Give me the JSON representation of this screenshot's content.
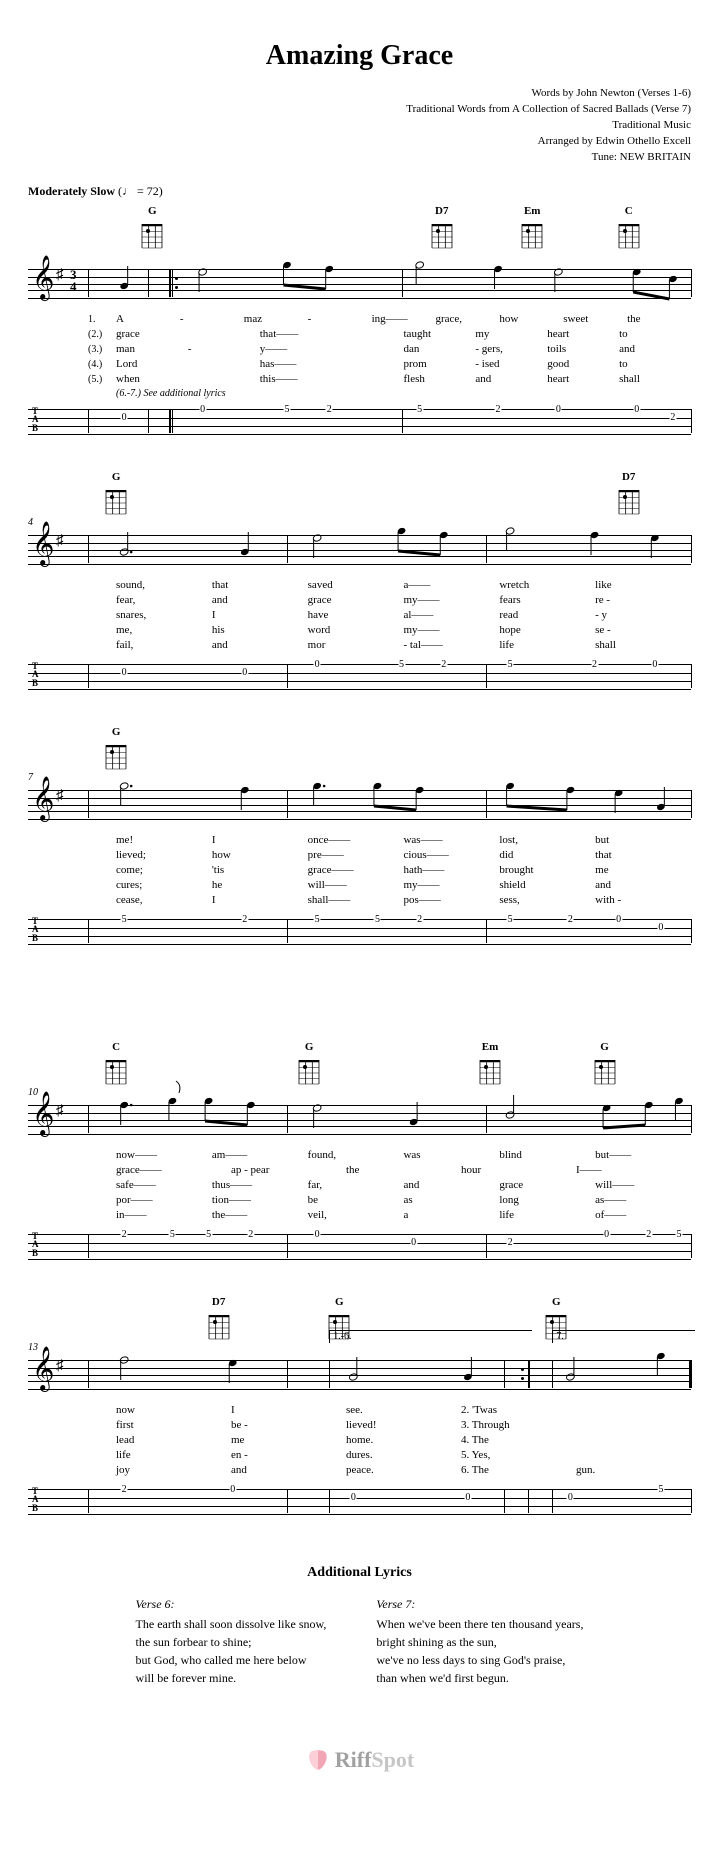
{
  "title": "Amazing Grace",
  "credits": [
    "Words by John Newton (Verses 1-6)",
    "Traditional Words from A Collection of Sacred Ballads (Verse 7)",
    "Traditional Music",
    "Arranged by Edwin Othello Excell",
    "Tune: NEW BRITAIN"
  ],
  "tempo": {
    "label": "Moderately Slow",
    "marking": "(♩ = 72)"
  },
  "time_signature": "3/4",
  "key": "G major",
  "chords_defs": {
    "G": {
      "label": "G"
    },
    "D7": {
      "label": "D7"
    },
    "Em": {
      "label": "Em"
    },
    "C": {
      "label": "C"
    }
  },
  "systems": [
    {
      "measnum": null,
      "chord_slots": [
        {
          "pos": 0.11,
          "chord": "G"
        },
        {
          "pos": 0.59,
          "chord": "D7"
        },
        {
          "pos": 0.74,
          "chord": "Em"
        },
        {
          "pos": 0.9,
          "chord": "C"
        }
      ],
      "barlines": [
        0.0,
        0.1,
        0.14,
        0.52,
        1.0
      ],
      "repeat_start_at": 0.14,
      "lyrics": [
        {
          "num": "1.",
          "syls": [
            "A",
            "-",
            "maz",
            "-",
            "ing——",
            "grace,",
            "how",
            "sweet",
            "the"
          ]
        },
        {
          "num": "(2.)",
          "syls": [
            "grace",
            "",
            "that——",
            "",
            "taught",
            "my",
            "heart",
            "to"
          ]
        },
        {
          "num": "(3.)",
          "syls": [
            "man",
            "-",
            "y——",
            "",
            "dan",
            "- gers,",
            "toils",
            "and"
          ]
        },
        {
          "num": "(4.)",
          "syls": [
            "Lord",
            "",
            "has——",
            "",
            "prom",
            "- ised",
            "good",
            "to"
          ]
        },
        {
          "num": "(5.)",
          "syls": [
            "when",
            "",
            "this——",
            "",
            "flesh",
            "and",
            "heart",
            "shall"
          ]
        }
      ],
      "lyrics_note": "(6.-7.)  See additional lyrics",
      "tab_notes": [
        {
          "pct": 6,
          "str": 1,
          "fret": "0"
        },
        {
          "pct": 19,
          "str": 0,
          "fret": "0"
        },
        {
          "pct": 33,
          "str": 0,
          "fret": "5"
        },
        {
          "pct": 40,
          "str": 0,
          "fret": "2"
        },
        {
          "pct": 55,
          "str": 0,
          "fret": "5"
        },
        {
          "pct": 68,
          "str": 0,
          "fret": "2"
        },
        {
          "pct": 78,
          "str": 0,
          "fret": "0"
        },
        {
          "pct": 91,
          "str": 0,
          "fret": "0"
        },
        {
          "pct": 97,
          "str": 1,
          "fret": "2"
        }
      ],
      "note_heads": [
        {
          "pct": 6,
          "y": 31,
          "stem": "up",
          "filled": true
        },
        {
          "pct": 19,
          "y": 17,
          "stem": "down",
          "filled": false
        },
        {
          "pct": 33,
          "y": 10,
          "stem": "down",
          "filled": true,
          "beam_to": 40
        },
        {
          "pct": 40,
          "y": 14,
          "stem": "down",
          "filled": true
        },
        {
          "pct": 55,
          "y": 10,
          "stem": "down",
          "filled": false
        },
        {
          "pct": 68,
          "y": 14,
          "stem": "down",
          "filled": true
        },
        {
          "pct": 78,
          "y": 17,
          "stem": "down",
          "filled": false
        },
        {
          "pct": 91,
          "y": 17,
          "stem": "down",
          "filled": true,
          "beam_to": 97
        },
        {
          "pct": 97,
          "y": 24,
          "stem": "down",
          "filled": true
        }
      ]
    },
    {
      "measnum": "4",
      "chord_slots": [
        {
          "pos": 0.05,
          "chord": "G"
        },
        {
          "pos": 0.9,
          "chord": "D7"
        }
      ],
      "barlines": [
        0.0,
        0.33,
        0.66,
        1.0
      ],
      "lyrics": [
        {
          "num": "",
          "syls": [
            "sound,",
            "that",
            "saved",
            "a——",
            "wretch",
            "like"
          ]
        },
        {
          "num": "",
          "syls": [
            "fear,",
            "and",
            "grace",
            "my——",
            "fears",
            "re -"
          ]
        },
        {
          "num": "",
          "syls": [
            "snares,",
            "I",
            "have",
            "al——",
            "read",
            "- y"
          ]
        },
        {
          "num": "",
          "syls": [
            "me,",
            "his",
            "word",
            "my——",
            "hope",
            "se -"
          ]
        },
        {
          "num": "",
          "syls": [
            "fail,",
            "and",
            "mor",
            "- tal——",
            "life",
            "shall"
          ]
        }
      ],
      "tab_notes": [
        {
          "pct": 6,
          "str": 1,
          "fret": "0"
        },
        {
          "pct": 26,
          "str": 1,
          "fret": "0"
        },
        {
          "pct": 38,
          "str": 0,
          "fret": "0"
        },
        {
          "pct": 52,
          "str": 0,
          "fret": "5"
        },
        {
          "pct": 59,
          "str": 0,
          "fret": "2"
        },
        {
          "pct": 70,
          "str": 0,
          "fret": "5"
        },
        {
          "pct": 84,
          "str": 0,
          "fret": "2"
        },
        {
          "pct": 94,
          "str": 0,
          "fret": "0"
        }
      ],
      "note_heads": [
        {
          "pct": 6,
          "y": 31,
          "stem": "up",
          "filled": false,
          "dot": true
        },
        {
          "pct": 26,
          "y": 31,
          "stem": "up",
          "filled": true
        },
        {
          "pct": 38,
          "y": 17,
          "stem": "down",
          "filled": false
        },
        {
          "pct": 52,
          "y": 10,
          "stem": "down",
          "filled": true,
          "beam_to": 59
        },
        {
          "pct": 59,
          "y": 14,
          "stem": "down",
          "filled": true
        },
        {
          "pct": 70,
          "y": 10,
          "stem": "down",
          "filled": false
        },
        {
          "pct": 84,
          "y": 14,
          "stem": "down",
          "filled": true
        },
        {
          "pct": 94,
          "y": 17,
          "stem": "down",
          "filled": true
        }
      ]
    },
    {
      "measnum": "7",
      "chord_slots": [
        {
          "pos": 0.05,
          "chord": "G"
        }
      ],
      "barlines": [
        0.0,
        0.33,
        0.66,
        1.0
      ],
      "lyrics": [
        {
          "num": "",
          "syls": [
            "me!",
            "I",
            "once——",
            "was——",
            "lost,",
            "but"
          ]
        },
        {
          "num": "",
          "syls": [
            "lieved;",
            "how",
            "pre——",
            "cious——",
            "did",
            "that"
          ]
        },
        {
          "num": "",
          "syls": [
            "come;",
            "'tis",
            "grace——",
            "hath——",
            "brought",
            "me"
          ]
        },
        {
          "num": "",
          "syls": [
            "cures;",
            "he",
            "will——",
            "my——",
            "shield",
            "and"
          ]
        },
        {
          "num": "",
          "syls": [
            "cease,",
            "I",
            "shall——",
            "pos——",
            "sess,",
            "with -"
          ]
        }
      ],
      "tab_notes": [
        {
          "pct": 6,
          "str": 0,
          "fret": "5"
        },
        {
          "pct": 26,
          "str": 0,
          "fret": "2"
        },
        {
          "pct": 38,
          "str": 0,
          "fret": "5"
        },
        {
          "pct": 48,
          "str": 0,
          "fret": "5"
        },
        {
          "pct": 55,
          "str": 0,
          "fret": "2"
        },
        {
          "pct": 70,
          "str": 0,
          "fret": "5"
        },
        {
          "pct": 80,
          "str": 0,
          "fret": "2"
        },
        {
          "pct": 88,
          "str": 0,
          "fret": "0"
        },
        {
          "pct": 95,
          "str": 1,
          "fret": "0"
        }
      ],
      "note_heads": [
        {
          "pct": 6,
          "y": 10,
          "stem": "down",
          "filled": false,
          "dot": true
        },
        {
          "pct": 26,
          "y": 14,
          "stem": "down",
          "filled": true
        },
        {
          "pct": 38,
          "y": 10,
          "stem": "down",
          "filled": true,
          "dot": true
        },
        {
          "pct": 48,
          "y": 10,
          "stem": "down",
          "filled": true,
          "beam_to": 55
        },
        {
          "pct": 55,
          "y": 14,
          "stem": "down",
          "filled": true
        },
        {
          "pct": 70,
          "y": 10,
          "stem": "down",
          "filled": true,
          "beam_to": 80
        },
        {
          "pct": 80,
          "y": 14,
          "stem": "down",
          "filled": true
        },
        {
          "pct": 88,
          "y": 17,
          "stem": "down",
          "filled": true
        },
        {
          "pct": 95,
          "y": 31,
          "stem": "up",
          "filled": true
        }
      ]
    },
    {
      "measnum": "10",
      "chord_slots": [
        {
          "pos": 0.05,
          "chord": "C"
        },
        {
          "pos": 0.37,
          "chord": "G"
        },
        {
          "pos": 0.67,
          "chord": "Em"
        },
        {
          "pos": 0.86,
          "chord": "G"
        }
      ],
      "barlines": [
        0.0,
        0.33,
        0.66,
        1.0
      ],
      "lyrics": [
        {
          "num": "",
          "syls": [
            "now——",
            "am——",
            "found,",
            "was",
            "blind",
            "but——"
          ]
        },
        {
          "num": "",
          "syls": [
            "grace——",
            "ap - pear",
            "the",
            "hour",
            "I——"
          ]
        },
        {
          "num": "",
          "syls": [
            "safe——",
            "thus——",
            "far,",
            "and",
            "grace",
            "will——"
          ]
        },
        {
          "num": "",
          "syls": [
            "por——",
            "tion——",
            "be",
            "as",
            "long",
            "as——"
          ]
        },
        {
          "num": "",
          "syls": [
            "in——",
            "the——",
            "veil,",
            "a",
            "life",
            "of——"
          ]
        }
      ],
      "tab_notes": [
        {
          "pct": 6,
          "str": 0,
          "fret": "2"
        },
        {
          "pct": 14,
          "str": 0,
          "fret": "5"
        },
        {
          "pct": 20,
          "str": 0,
          "fret": "5"
        },
        {
          "pct": 27,
          "str": 0,
          "fret": "2"
        },
        {
          "pct": 38,
          "str": 0,
          "fret": "0"
        },
        {
          "pct": 54,
          "str": 1,
          "fret": "0"
        },
        {
          "pct": 70,
          "str": 1,
          "fret": "2"
        },
        {
          "pct": 86,
          "str": 0,
          "fret": "0"
        },
        {
          "pct": 93,
          "str": 0,
          "fret": "2"
        },
        {
          "pct": 98,
          "str": 0,
          "fret": "5"
        }
      ],
      "note_heads": [
        {
          "pct": 6,
          "y": 14,
          "stem": "down",
          "filled": true,
          "dot": true
        },
        {
          "pct": 14,
          "y": 10,
          "stem": "down",
          "filled": true,
          "flag": true
        },
        {
          "pct": 20,
          "y": 10,
          "stem": "down",
          "filled": true,
          "beam_to": 27
        },
        {
          "pct": 27,
          "y": 14,
          "stem": "down",
          "filled": true
        },
        {
          "pct": 38,
          "y": 17,
          "stem": "down",
          "filled": false
        },
        {
          "pct": 54,
          "y": 31,
          "stem": "up",
          "filled": true
        },
        {
          "pct": 70,
          "y": 24,
          "stem": "up",
          "filled": false
        },
        {
          "pct": 86,
          "y": 17,
          "stem": "down",
          "filled": true,
          "beam_to": 93
        },
        {
          "pct": 93,
          "y": 14,
          "stem": "down",
          "filled": true
        },
        {
          "pct": 98,
          "y": 10,
          "stem": "down",
          "filled": true
        }
      ]
    },
    {
      "measnum": "13",
      "chord_slots": [
        {
          "pos": 0.22,
          "chord": "D7"
        },
        {
          "pos": 0.42,
          "chord": "G"
        },
        {
          "pos": 0.78,
          "chord": "G"
        }
      ],
      "barlines": [
        0.0,
        0.33,
        0.4,
        0.69,
        0.73,
        0.77,
        1.0
      ],
      "repeat_end_at": 0.73,
      "end_barline_at": 1.0,
      "endings": [
        {
          "label": "1.-6.",
          "from": 0.4,
          "to": 0.73
        },
        {
          "label": "7.",
          "from": 0.77,
          "to": 1.0
        }
      ],
      "lyrics": [
        {
          "num": "",
          "syls": [
            "now",
            "I",
            "see.",
            "2. 'Twas",
            ""
          ]
        },
        {
          "num": "",
          "syls": [
            "first",
            "be -",
            "lieved!",
            "3. Through",
            ""
          ]
        },
        {
          "num": "",
          "syls": [
            "lead",
            "me",
            "home.",
            "4. The",
            ""
          ]
        },
        {
          "num": "",
          "syls": [
            "life",
            "en -",
            "dures.",
            "5. Yes,",
            ""
          ]
        },
        {
          "num": "",
          "syls": [
            "joy",
            "and",
            "peace.",
            "6. The",
            "gun."
          ]
        }
      ],
      "tab_notes": [
        {
          "pct": 6,
          "str": 0,
          "fret": "2"
        },
        {
          "pct": 24,
          "str": 0,
          "fret": "0"
        },
        {
          "pct": 44,
          "str": 1,
          "fret": "0"
        },
        {
          "pct": 63,
          "str": 1,
          "fret": "0"
        },
        {
          "pct": 80,
          "str": 1,
          "fret": "0"
        },
        {
          "pct": 95,
          "str": 0,
          "fret": "5"
        }
      ],
      "note_heads": [
        {
          "pct": 6,
          "y": 14,
          "stem": "down",
          "filled": false
        },
        {
          "pct": 24,
          "y": 17,
          "stem": "down",
          "filled": true
        },
        {
          "pct": 44,
          "y": 31,
          "stem": "up",
          "filled": false
        },
        {
          "pct": 63,
          "y": 31,
          "stem": "up",
          "filled": true
        },
        {
          "pct": 80,
          "y": 31,
          "stem": "up",
          "filled": false
        },
        {
          "pct": 95,
          "y": 10,
          "stem": "down",
          "filled": true
        }
      ]
    }
  ],
  "additional_lyrics": {
    "heading": "Additional Lyrics",
    "verses": [
      {
        "title": "Verse 6:",
        "lines": [
          "The earth shall soon dissolve like snow,",
          "the sun forbear to shine;",
          "but God, who called me here below",
          "will be forever mine."
        ]
      },
      {
        "title": "Verse 7:",
        "lines": [
          "When we've been there ten thousand years,",
          "bright shining as the sun,",
          "we've no less days to sing God's praise,",
          "than when we'd first begun."
        ]
      }
    ]
  },
  "footer": {
    "brand": "RiffSpot"
  }
}
